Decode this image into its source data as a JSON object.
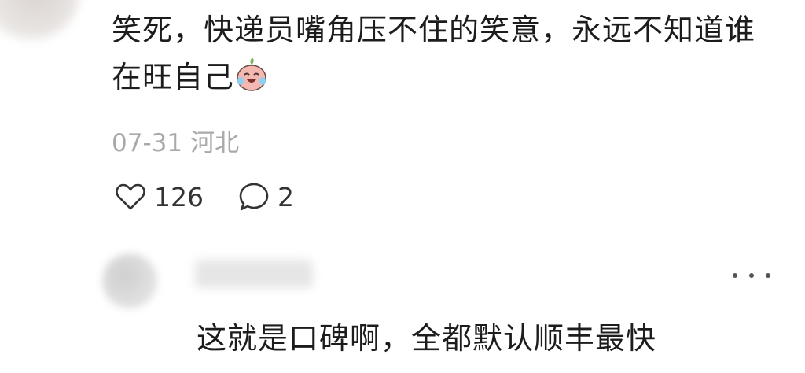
{
  "comment": {
    "text": "笑死，快递员嘴角压不住的笑意，永远不知道谁在旺自己",
    "emoji": "laughing-crying-face-icon",
    "date": "07-31",
    "location": "河北",
    "likes": "126",
    "replies": "2"
  },
  "reply": {
    "text": "这就是口碑啊，全都默认顺丰最快"
  },
  "colors": {
    "text": "#1c1c1c",
    "meta": "#a9a9a9",
    "icon": "#333333"
  }
}
